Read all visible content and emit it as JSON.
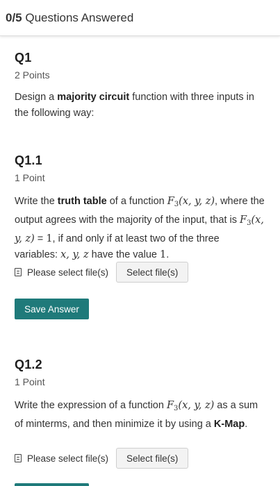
{
  "header": {
    "answered_count": "0/5",
    "answered_label": "Questions Answered"
  },
  "q1": {
    "title": "Q1",
    "points": "2 Points",
    "text_a": "Design a ",
    "text_bold": "majority circuit",
    "text_b": " function with three inputs in the following way:"
  },
  "q1_1": {
    "title": "Q1.1",
    "points": "1 Point",
    "t1": "Write the ",
    "t1_bold": "truth table",
    "t2": " of a function ",
    "t3": ", where the output agrees with the majority of the input, that is ",
    "t4": " = ",
    "t5": ", if and only if at least two of the three variables: ",
    "t6": " have the value ",
    "t7": ".",
    "math_func": "F",
    "math_sub": "3",
    "math_args": "(x, y, z)",
    "math_one": "1",
    "math_vars": "x, y, z",
    "upload_label": "Please select file(s)",
    "select_button": "Select file(s)",
    "save_button": "Save Answer"
  },
  "q1_2": {
    "title": "Q1.2",
    "points": "1 Point",
    "t1": "Write the expression of a function ",
    "t2": " as a sum of minterms, and then minimize it by using a ",
    "t2_bold": "K-Map",
    "t3": ".",
    "math_func": "F",
    "math_sub": "3",
    "math_args": "(x, y, z)",
    "upload_label": "Please select file(s)",
    "select_button": "Select file(s)"
  }
}
